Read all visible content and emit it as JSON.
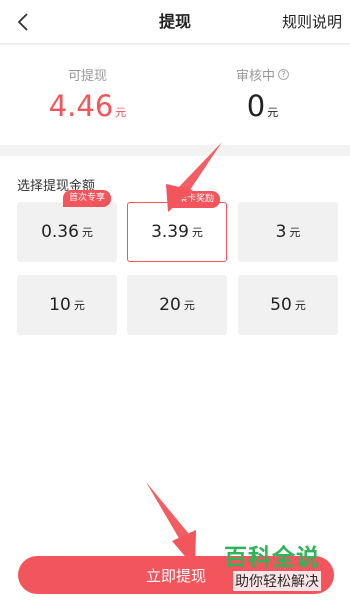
{
  "nav": {
    "title": "提现",
    "rules_label": "规则说明",
    "back_icon": "chevron-left-icon"
  },
  "summary": {
    "available_label": "可提现",
    "available_value": "4.46",
    "available_unit": "元",
    "review_label": "审核中",
    "review_value": "0",
    "review_unit": "元",
    "help_icon": "question-circle-icon",
    "help_glyph": "?"
  },
  "amount_section": {
    "title": "选择提现金额",
    "options": [
      {
        "value": "0.36",
        "unit": "元",
        "tag": "首次专享"
      },
      {
        "value": "3.39",
        "unit": "元",
        "tag": "集卡奖励",
        "selected": true
      },
      {
        "value": "3",
        "unit": "元"
      },
      {
        "value": "10",
        "unit": "元"
      },
      {
        "value": "20",
        "unit": "元"
      },
      {
        "value": "50",
        "unit": "元"
      }
    ]
  },
  "submit": {
    "label": "立即提现"
  },
  "watermark": {
    "main": "百科全说",
    "sub": "助你轻松解决"
  },
  "colors": {
    "accent": "#f2555c",
    "watermark_green": "#2fb45a"
  }
}
